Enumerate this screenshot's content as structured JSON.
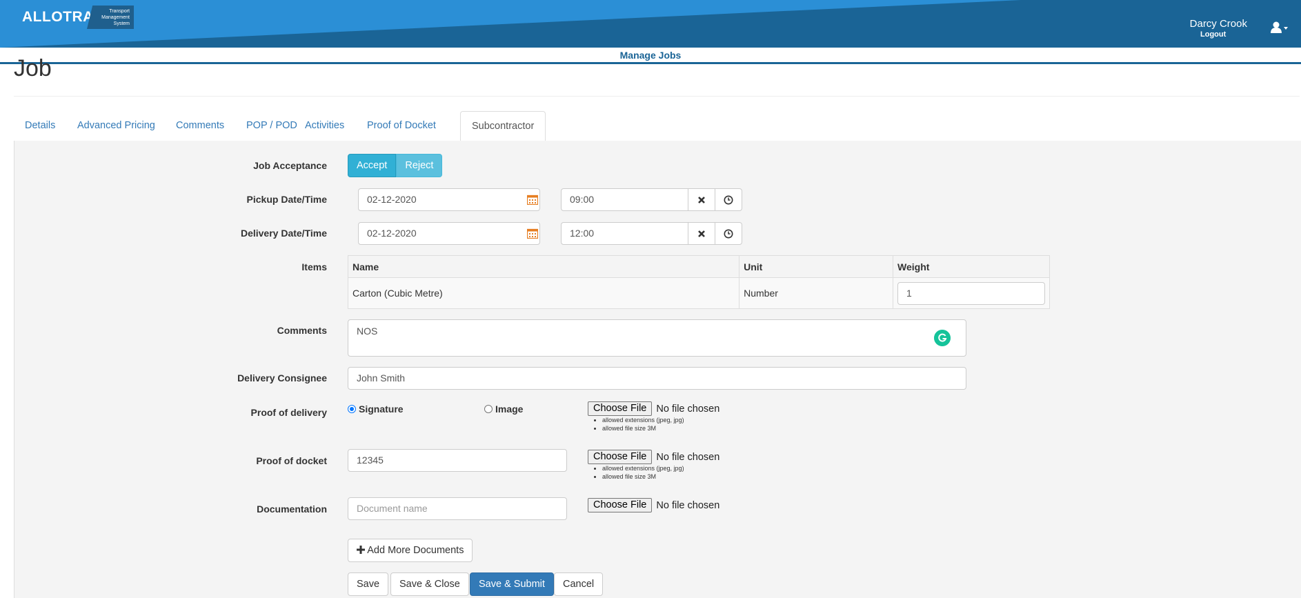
{
  "header": {
    "logo_text": "ALLOTRAC",
    "logo_sub": "Transport Management System",
    "user_name": "Darcy Crook",
    "logout_label": "Logout",
    "nav_label": "Manage Jobs",
    "colors": {
      "bar": "#1a6496",
      "bar_light": "#2b8fd6"
    }
  },
  "page": {
    "title": "Job",
    "tabs": [
      {
        "label": "Details",
        "active": false
      },
      {
        "label": "Advanced Pricing",
        "active": false
      },
      {
        "label": "Comments",
        "active": false
      },
      {
        "label": "POP / POD",
        "active": false
      },
      {
        "label": "Activities",
        "active": false
      },
      {
        "label": "Proof of Docket",
        "active": false
      },
      {
        "label": "Subcontractor",
        "active": true
      }
    ]
  },
  "form": {
    "job_acceptance": {
      "label": "Job Acceptance",
      "accept_label": "Accept",
      "reject_label": "Reject",
      "selected": "Accept"
    },
    "pickup": {
      "label": "Pickup Date/Time",
      "date": "02-12-2020",
      "time": "09:00"
    },
    "delivery": {
      "label": "Delivery Date/Time",
      "date": "02-12-2020",
      "time": "12:00"
    },
    "items": {
      "label": "Items",
      "columns": [
        "Name",
        "Unit",
        "Weight"
      ],
      "rows": [
        {
          "name": "Carton (Cubic Metre)",
          "unit": "Number",
          "weight": "1"
        }
      ]
    },
    "comments": {
      "label": "Comments",
      "value": "NOS"
    },
    "consignee": {
      "label": "Delivery Consignee",
      "value": "John Smith"
    },
    "proof_of_delivery": {
      "label": "Proof of delivery",
      "option_signature": "Signature",
      "option_image": "Image",
      "selected": "Signature",
      "file_button": "Choose File",
      "file_status": "No file chosen",
      "hints": [
        "allowed extensions (jpeg, jpg)",
        "allowed file size 3M"
      ]
    },
    "proof_of_docket": {
      "label": "Proof of docket",
      "value": "12345",
      "file_button": "Choose File",
      "file_status": "No file chosen",
      "hints": [
        "allowed extensions (jpeg, jpg)",
        "allowed file size 3M"
      ]
    },
    "documentation": {
      "label": "Documentation",
      "placeholder": "Document name",
      "file_button": "Choose File",
      "file_status": "No file chosen"
    },
    "add_more_label": "Add More Documents",
    "actions": {
      "save": "Save",
      "save_close": "Save & Close",
      "save_submit": "Save & Submit",
      "cancel": "Cancel"
    }
  }
}
